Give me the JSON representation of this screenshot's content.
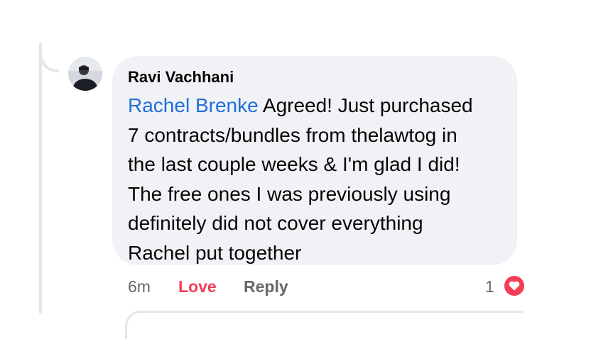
{
  "comment": {
    "author": "Ravi Vachhani",
    "mention": "Rachel Brenke",
    "lines": [
      " Agreed! Just purchased",
      "7 contracts/bundles from thelawtog in",
      "the last couple weeks & I'm glad I did!",
      "The free ones I was previously using",
      "definitely did not cover everything",
      "Rachel put together"
    ],
    "timestamp": "6m",
    "reaction_label": "Love",
    "reply_label": "Reply",
    "reaction_count": "1",
    "reaction_icon": "heart-icon"
  },
  "colors": {
    "bubble": "#f0f2f5",
    "mention": "#216fdb",
    "love": "#f33e58",
    "meta": "#65676b"
  }
}
